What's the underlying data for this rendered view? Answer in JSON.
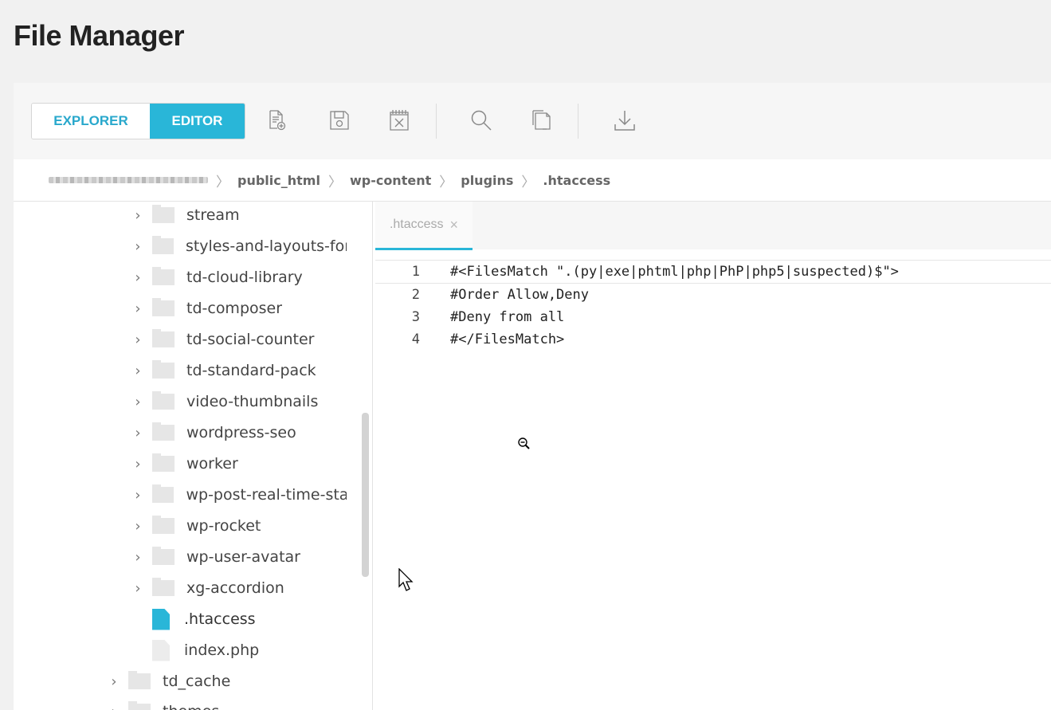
{
  "page_title": "File Manager",
  "modes": {
    "explorer": "EXPLORER",
    "editor": "EDITOR"
  },
  "toolbar_icons": [
    "new-file-icon",
    "save-icon",
    "close-file-icon",
    "search-icon",
    "copy-icon",
    "download-icon"
  ],
  "breadcrumb": {
    "root_blurred": "",
    "items": [
      "public_html",
      "wp-content",
      "plugins",
      ".htaccess"
    ]
  },
  "tree": {
    "items": [
      {
        "label": "stream",
        "type": "folder"
      },
      {
        "label": "styles-and-layouts-for",
        "type": "folder"
      },
      {
        "label": "td-cloud-library",
        "type": "folder"
      },
      {
        "label": "td-composer",
        "type": "folder"
      },
      {
        "label": "td-social-counter",
        "type": "folder"
      },
      {
        "label": "td-standard-pack",
        "type": "folder"
      },
      {
        "label": "video-thumbnails",
        "type": "folder"
      },
      {
        "label": "wordpress-seo",
        "type": "folder"
      },
      {
        "label": "worker",
        "type": "folder"
      },
      {
        "label": "wp-post-real-time-sta",
        "type": "folder"
      },
      {
        "label": "wp-rocket",
        "type": "folder"
      },
      {
        "label": "wp-user-avatar",
        "type": "folder"
      },
      {
        "label": "xg-accordion",
        "type": "folder"
      },
      {
        "label": ".htaccess",
        "type": "file",
        "active": true
      },
      {
        "label": "index.php",
        "type": "file"
      },
      {
        "label": "td_cache",
        "type": "folder"
      },
      {
        "label": "themes",
        "type": "folder"
      }
    ]
  },
  "editor": {
    "tab_label": ".htaccess",
    "tab_close": "×",
    "lines": [
      {
        "n": "1",
        "text": "#<FilesMatch \".(py|exe|phtml|php|PhP|php5|suspected)$\">"
      },
      {
        "n": "2",
        "text": "#Order Allow,Deny"
      },
      {
        "n": "3",
        "text": "#Deny from all"
      },
      {
        "n": "4",
        "text": "#</FilesMatch>"
      }
    ]
  },
  "colors": {
    "accent": "#29b6d8",
    "accent_text": "#29a8cc"
  }
}
